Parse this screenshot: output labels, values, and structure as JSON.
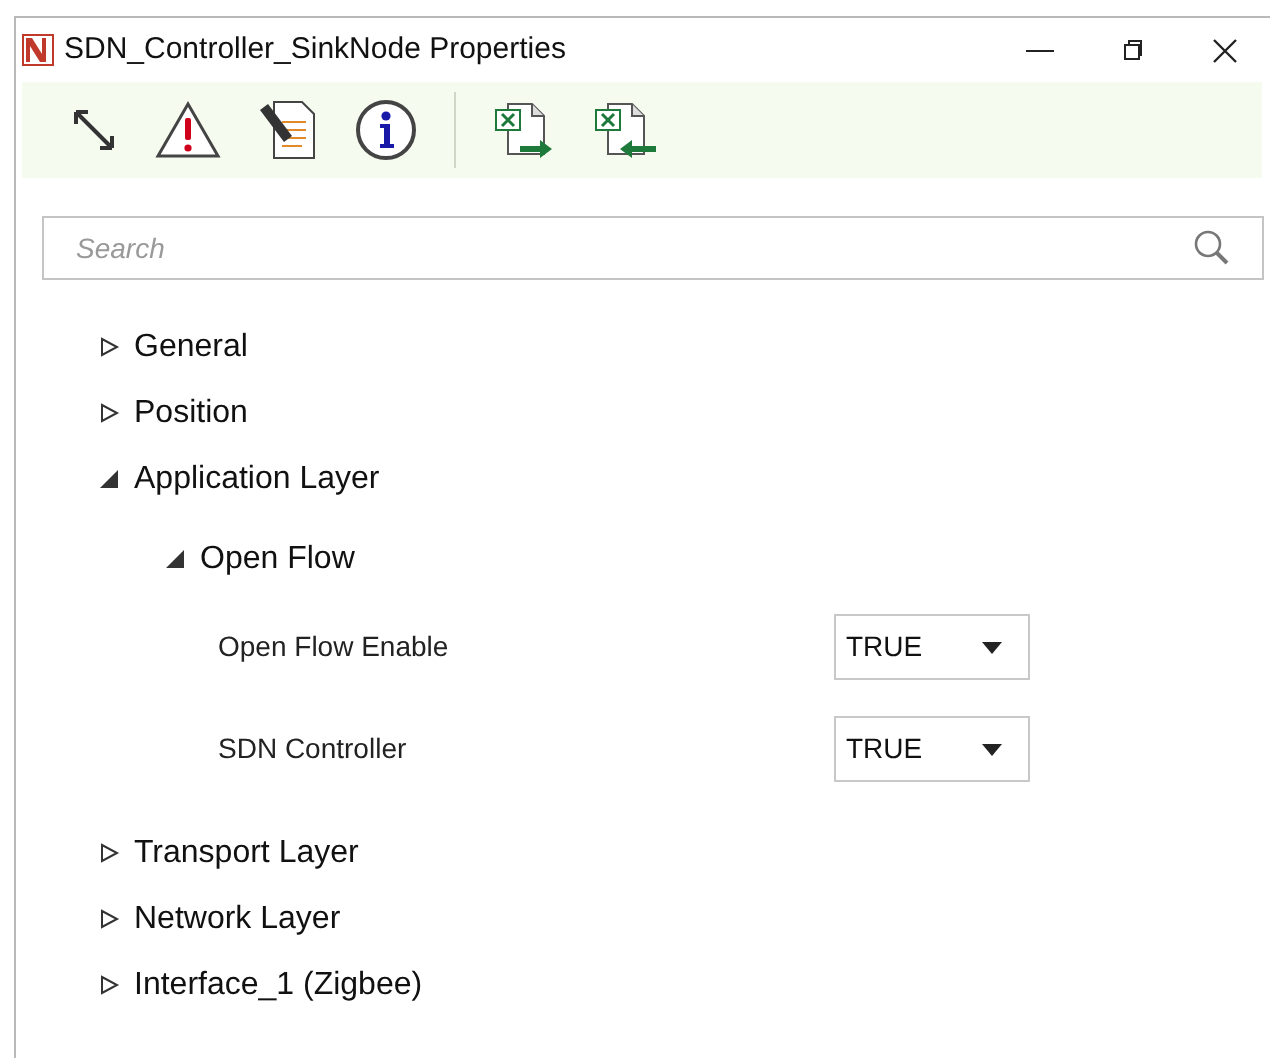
{
  "window": {
    "title": "SDN_Controller_SinkNode Properties"
  },
  "search": {
    "placeholder": "Search"
  },
  "tree": [
    {
      "kind": "group",
      "label": "General",
      "expanded": false
    },
    {
      "kind": "group",
      "label": "Position",
      "expanded": false
    },
    {
      "kind": "group",
      "label": "Application Layer",
      "expanded": true,
      "children": [
        {
          "kind": "group",
          "label": "Open Flow",
          "expanded": true,
          "children": [
            {
              "kind": "property",
              "label": "Open Flow Enable",
              "value": "TRUE"
            },
            {
              "kind": "property",
              "label": "SDN Controller",
              "value": "TRUE"
            }
          ]
        }
      ]
    },
    {
      "kind": "group",
      "label": "Transport Layer",
      "expanded": false
    },
    {
      "kind": "group",
      "label": "Network Layer",
      "expanded": false
    },
    {
      "kind": "group",
      "label": "Interface_1 (Zigbee)",
      "expanded": false
    }
  ]
}
